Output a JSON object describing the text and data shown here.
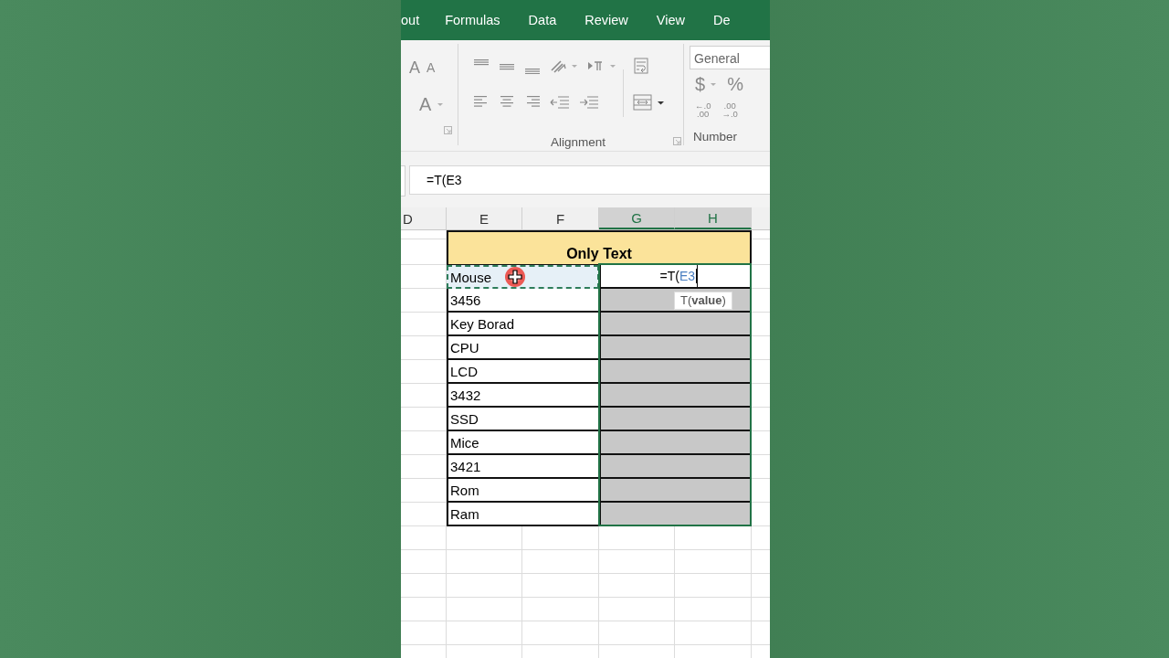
{
  "ribbon": {
    "tabs": [
      "out",
      "Formulas",
      "Data",
      "Review",
      "View",
      "De"
    ],
    "font_buttons": [
      {
        "kind": "grow",
        "label": "A"
      },
      {
        "kind": "shrink",
        "label": "A"
      },
      {
        "kind": "color",
        "label": "A"
      }
    ],
    "groups": [
      {
        "label": "Alignment"
      },
      {
        "label": "Number"
      }
    ],
    "number_format": "General",
    "number_buttons": [
      {
        "kind": "currency",
        "label": "$"
      },
      {
        "kind": "percent",
        "label": "%"
      }
    ],
    "decimal_buttons": [
      {
        "top": "←.0",
        "bottom": ".00"
      },
      {
        "top": ".00",
        "bottom": "→.0"
      }
    ]
  },
  "formula_bar": {
    "value": "=T(E3"
  },
  "columns": [
    {
      "label": "D",
      "selected": false
    },
    {
      "label": "E",
      "selected": false
    },
    {
      "label": "F",
      "selected": false
    },
    {
      "label": "G",
      "selected": true
    },
    {
      "label": "H",
      "selected": true
    }
  ],
  "sheet": {
    "title": "Only Text",
    "rows": [
      {
        "value": "Mouse",
        "referenced": true,
        "editing": true
      },
      {
        "value": "3456",
        "referenced": false,
        "editing": false
      },
      {
        "value": "Key Borad",
        "referenced": false,
        "editing": false
      },
      {
        "value": "CPU",
        "referenced": false,
        "editing": false
      },
      {
        "value": "LCD",
        "referenced": false,
        "editing": false
      },
      {
        "value": "3432",
        "referenced": false,
        "editing": false
      },
      {
        "value": "SSD",
        "referenced": false,
        "editing": false
      },
      {
        "value": "Mice",
        "referenced": false,
        "editing": false
      },
      {
        "value": "3421",
        "referenced": false,
        "editing": false
      },
      {
        "value": "Rom",
        "referenced": false,
        "editing": false
      },
      {
        "value": "Ram",
        "referenced": false,
        "editing": false
      }
    ]
  },
  "editing_cell": {
    "prefix": "=T(",
    "reference": "E3"
  },
  "tooltip": "T(**value**)"
}
